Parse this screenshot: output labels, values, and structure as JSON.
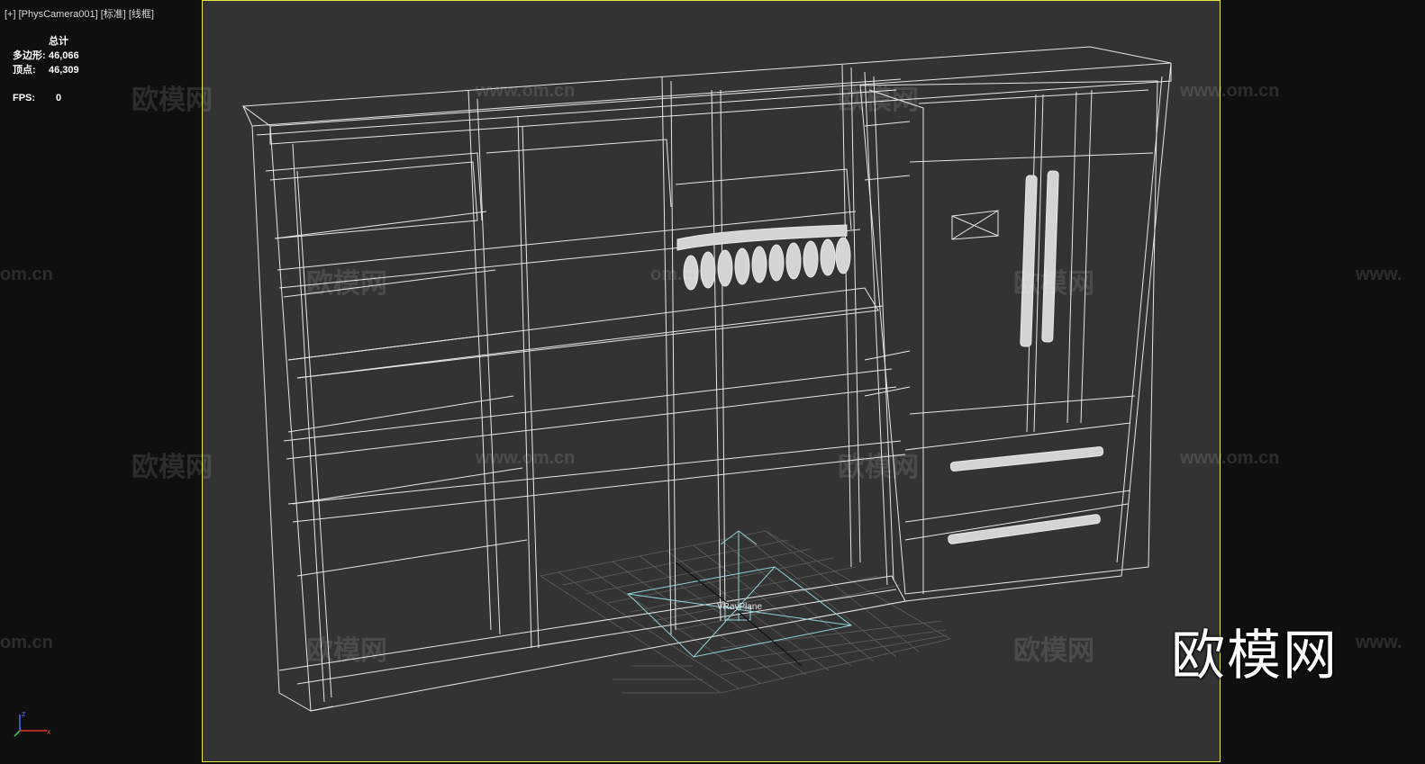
{
  "viewport": {
    "label": "[+] [PhysCamera001] [标准] [线框]",
    "background": "#333333",
    "frame_color": "#e6e645"
  },
  "stats": {
    "header": "总计",
    "polygons_label": "多边形:",
    "polygons_value": "46,066",
    "vertices_label": "顶点:",
    "vertices_value": "46,309",
    "fps_label": "FPS:",
    "fps_value": "0"
  },
  "scene": {
    "light_label": "VRayPlane",
    "wire_color": "#e8e8e8",
    "grid_color": "#666666",
    "gizmo_color": "#8fd3d8"
  },
  "watermarks": {
    "cn": "欧模网",
    "url": "www.om.cn",
    "url_short": "om.cn",
    "url_trunc": "www.",
    "brand": "欧模网"
  },
  "axis_tripod": {
    "x": "x",
    "z": "z"
  }
}
